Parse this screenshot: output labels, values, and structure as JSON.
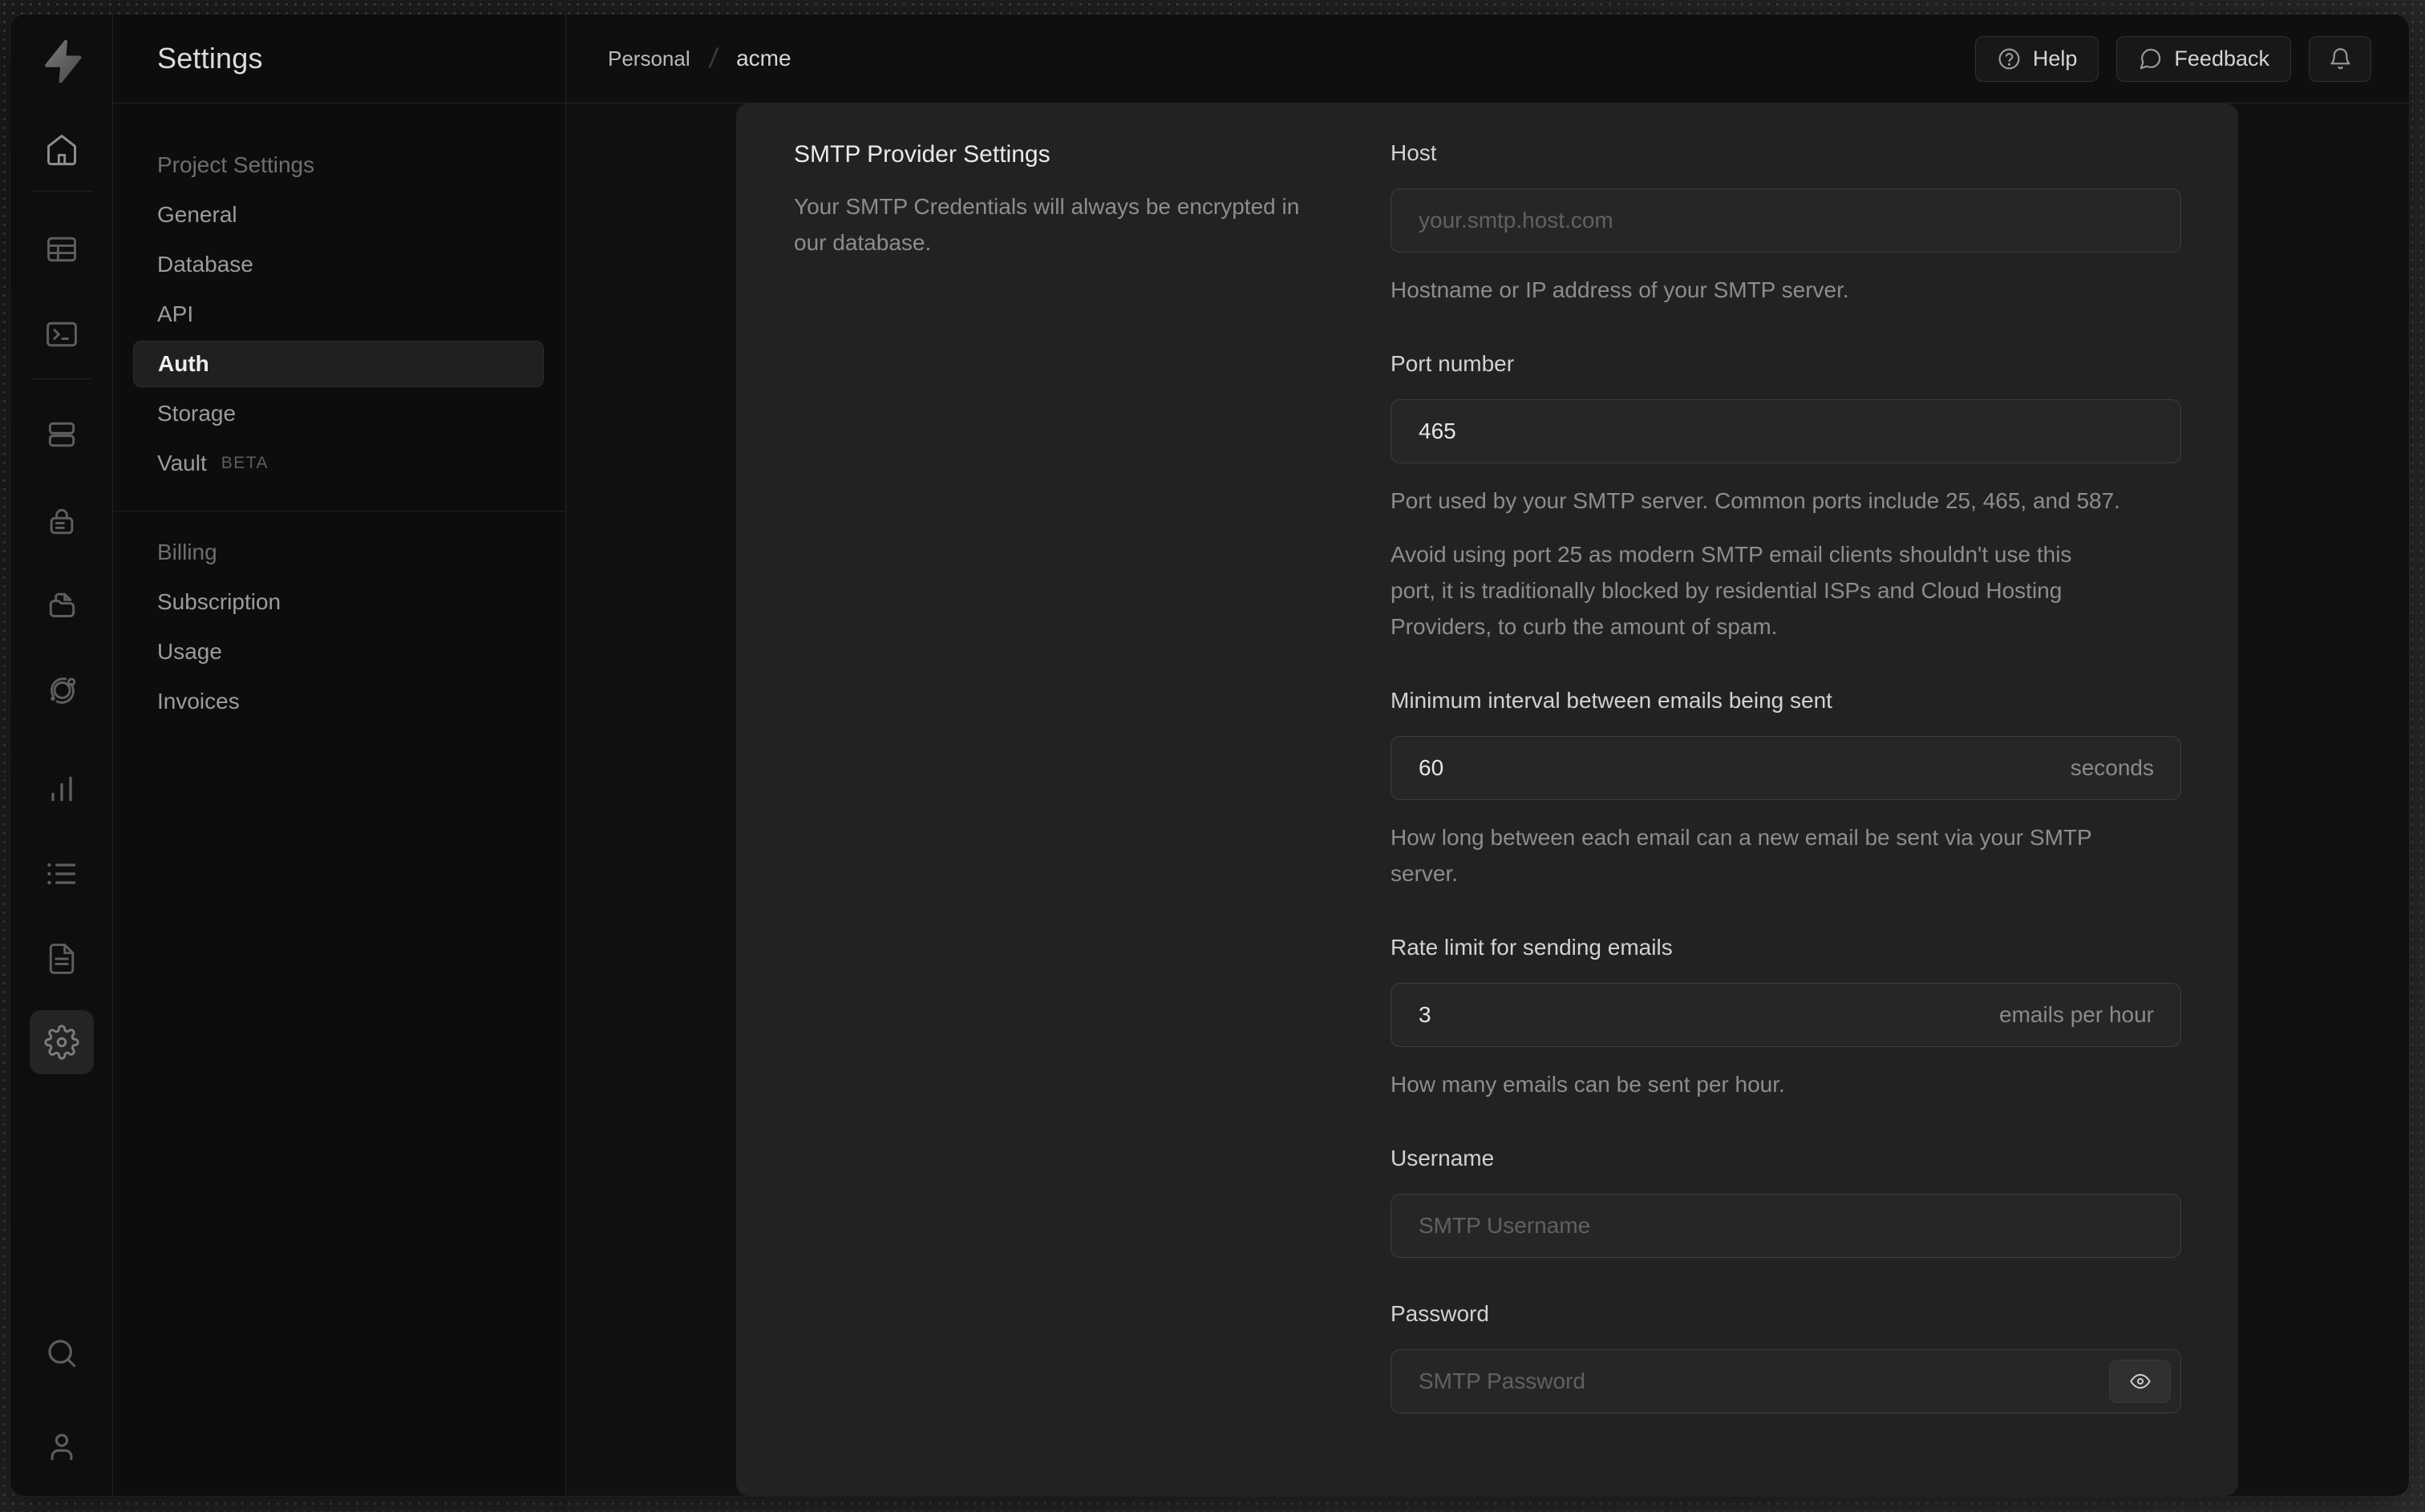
{
  "colors": {
    "backdrop": "#262626",
    "window_bg": "#0f0f0f",
    "card_bg": "#222222",
    "input_bg": "#262626",
    "input_border": "#3d3d3d",
    "accent_text": "#e8e8e8",
    "muted_text": "#8d8d8d",
    "selected_pill_bg": "#202020"
  },
  "rail": {
    "icons": [
      "supabase-logo-icon",
      "home-icon",
      "table-editor-icon",
      "sql-editor-icon",
      "database-icon",
      "auth-lock-icon",
      "storage-icon",
      "edge-functions-icon",
      "reports-icon",
      "logs-icon",
      "docs-icon",
      "settings-gear-icon",
      "search-icon",
      "user-icon"
    ]
  },
  "sidebar": {
    "title": "Settings",
    "sections": [
      {
        "header": "Project Settings",
        "items": [
          {
            "label": "General"
          },
          {
            "label": "Database"
          },
          {
            "label": "API"
          },
          {
            "label": "Auth",
            "active": true
          },
          {
            "label": "Storage"
          },
          {
            "label": "Vault",
            "badge": "BETA"
          }
        ]
      },
      {
        "header": "Billing",
        "items": [
          {
            "label": "Subscription"
          },
          {
            "label": "Usage"
          },
          {
            "label": "Invoices"
          }
        ]
      }
    ]
  },
  "header": {
    "breadcrumb": [
      "Personal",
      "acme"
    ],
    "help_label": "Help",
    "feedback_label": "Feedback",
    "bell_icon": "bell-icon"
  },
  "panel": {
    "title": "SMTP Provider Settings",
    "description": "Your SMTP Credentials will always be encrypted in our database.",
    "fields": [
      {
        "id": "host",
        "label": "Host",
        "value": "",
        "placeholder": "your.smtp.host.com",
        "helper": [
          "Hostname or IP address of your SMTP server."
        ]
      },
      {
        "id": "port",
        "label": "Port number",
        "value": "465",
        "helper": [
          "Port used by your SMTP server. Common ports include 25, 465, and 587.",
          "Avoid using port 25 as modern SMTP email clients shouldn't use this port, it is traditionally blocked by residential ISPs and Cloud Hosting Providers, to curb the amount of spam."
        ]
      },
      {
        "id": "minimum-interval",
        "label": "Minimum interval between emails being sent",
        "value": "60",
        "suffix": "seconds",
        "helper": [
          "How long between each email can a new email be sent via your SMTP server."
        ]
      },
      {
        "id": "rate-limit",
        "label": "Rate limit for sending emails",
        "value": "3",
        "suffix": "emails per hour",
        "helper": [
          "How many emails can be sent per hour."
        ]
      },
      {
        "id": "username",
        "label": "Username",
        "value": "",
        "placeholder": "SMTP Username"
      },
      {
        "id": "password",
        "label": "Password",
        "value": "",
        "placeholder": "SMTP Password",
        "eye_icon": "eye-icon"
      }
    ]
  }
}
